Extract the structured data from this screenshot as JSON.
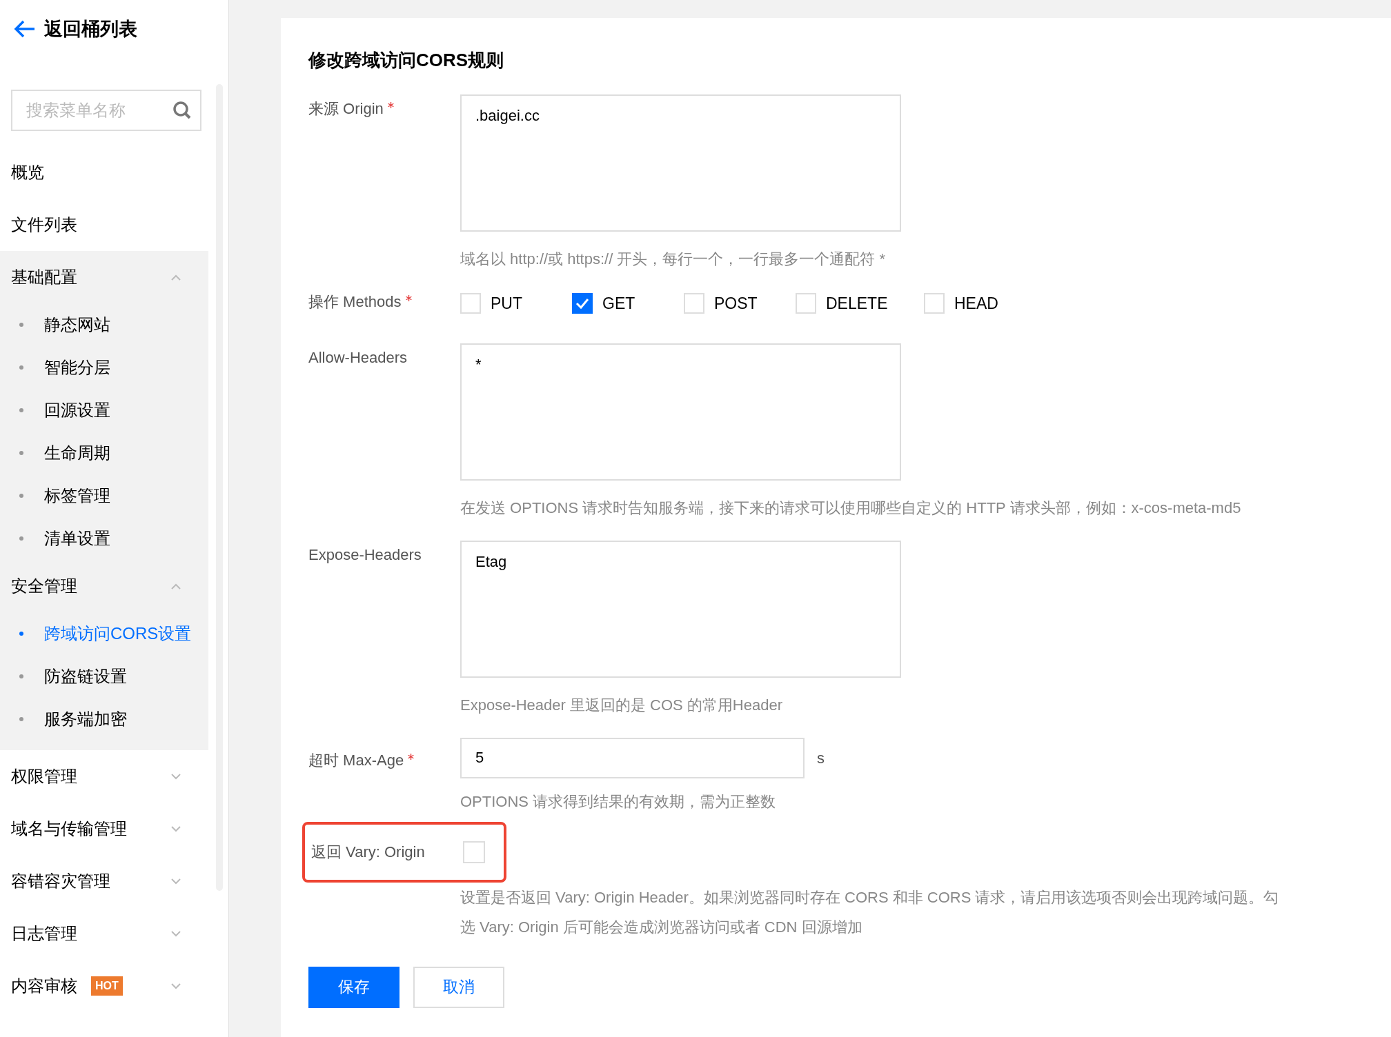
{
  "sidebar": {
    "back_link": "返回桶列表",
    "search": {
      "placeholder": "搜索菜单名称"
    },
    "menu": [
      {
        "label": "概览",
        "kind": "item"
      },
      {
        "label": "文件列表",
        "kind": "item"
      },
      {
        "label": "基础配置",
        "kind": "group",
        "expanded": true,
        "children": [
          {
            "label": "静态网站",
            "selected": false
          },
          {
            "label": "智能分层",
            "selected": false
          },
          {
            "label": "回源设置",
            "selected": false
          },
          {
            "label": "生命周期",
            "selected": false
          },
          {
            "label": "标签管理",
            "selected": false
          },
          {
            "label": "清单设置",
            "selected": false
          }
        ]
      },
      {
        "label": "安全管理",
        "kind": "group",
        "expanded": true,
        "children": [
          {
            "label": "跨域访问CORS设置",
            "selected": true
          },
          {
            "label": "防盗链设置",
            "selected": false
          },
          {
            "label": "服务端加密",
            "selected": false
          }
        ]
      },
      {
        "label": "权限管理",
        "kind": "group",
        "expanded": false
      },
      {
        "label": "域名与传输管理",
        "kind": "group",
        "expanded": false
      },
      {
        "label": "容错容灾管理",
        "kind": "group",
        "expanded": false
      },
      {
        "label": "日志管理",
        "kind": "group",
        "expanded": false
      },
      {
        "label": "内容审核",
        "kind": "group",
        "expanded": false,
        "badge": "HOT"
      }
    ]
  },
  "form": {
    "title": "修改跨域访问CORS规则",
    "fields": [
      {
        "kind": "textarea",
        "label": "来源 Origin",
        "required": true,
        "value": ".baigei.cc",
        "help": "域名以 http://或 https:// 开头，每行一个，一行最多一个通配符 *"
      },
      {
        "kind": "methods",
        "label": "操作 Methods",
        "required": true,
        "options": [
          {
            "label": "PUT",
            "checked": false
          },
          {
            "label": "GET",
            "checked": true
          },
          {
            "label": "POST",
            "checked": false
          },
          {
            "label": "DELETE",
            "checked": false
          },
          {
            "label": "HEAD",
            "checked": false
          }
        ]
      },
      {
        "kind": "textarea",
        "label": "Allow-Headers",
        "required": false,
        "value": "*",
        "help": "在发送 OPTIONS 请求时告知服务端，接下来的请求可以使用哪些自定义的 HTTP 请求头部，例如：x-cos-meta-md5"
      },
      {
        "kind": "textarea",
        "label": "Expose-Headers",
        "required": false,
        "value": "Etag",
        "help": "Expose-Header 里返回的是 COS 的常用Header"
      },
      {
        "kind": "input",
        "label": "超时 Max-Age",
        "required": true,
        "value": "5",
        "unit": "s",
        "help": "OPTIONS 请求得到结果的有效期，需为正整数"
      },
      {
        "kind": "checkbox",
        "label": "返回 Vary: Origin",
        "required": false,
        "checked": false,
        "highlighted": true,
        "help": "设置是否返回 Vary: Origin Header。如果浏览器同时存在 CORS 和非 CORS 请求，请启用该选项否则会出现跨域问题。勾选 Vary: Origin 后可能会造成浏览器访问或者 CDN 回源增加"
      }
    ],
    "buttons": [
      {
        "label": "保存",
        "kind": "primary"
      },
      {
        "label": "取消",
        "kind": "secondary"
      }
    ]
  }
}
